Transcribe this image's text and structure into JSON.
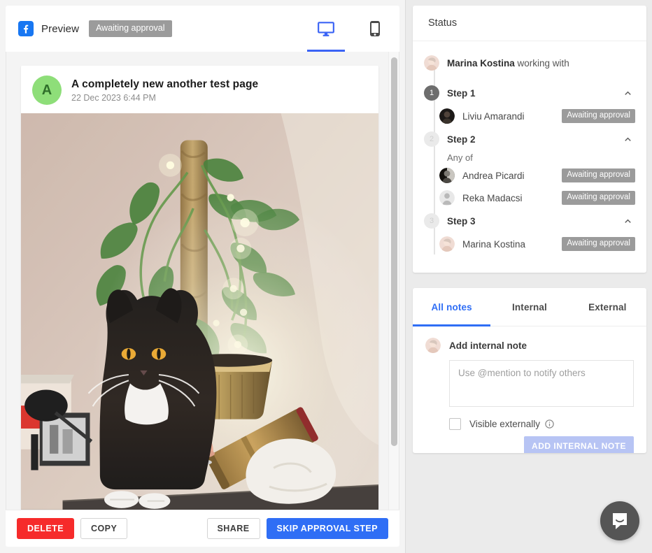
{
  "preview": {
    "network_icon": "facebook-icon",
    "title": "Preview",
    "status_chip": "Awaiting approval",
    "devices": [
      {
        "name": "desktop-icon",
        "active": true
      },
      {
        "name": "mobile-icon",
        "active": false
      }
    ],
    "post": {
      "avatar_letter": "A",
      "page_name": "A completely new another test page",
      "date": "22 Dec 2023 6:44 PM",
      "image_alt": "Black and white cat sitting on a dark sideboard in front of a pothos plant on a moss pole with fairy lights"
    },
    "footer": {
      "delete_label": "DELETE",
      "copy_label": "COPY",
      "share_label": "SHARE",
      "skip_label": "SKIP APPROVAL STEP"
    }
  },
  "status": {
    "heading": "Status",
    "owner_name": "Marina Kostina",
    "owner_suffix": " working with",
    "steps": [
      {
        "number": "1",
        "label": "Step 1",
        "state": "active",
        "any_of": null,
        "approvers": [
          {
            "name": "Liviu Amarandi",
            "badge": "Awaiting approval",
            "avatar": "avatar-dark"
          }
        ]
      },
      {
        "number": "2",
        "label": "Step 2",
        "state": "idle",
        "any_of": "Any of",
        "approvers": [
          {
            "name": "Andrea Picardi",
            "badge": "Awaiting approval",
            "avatar": "avatar-bw"
          },
          {
            "name": "Reka Madacsi",
            "badge": "Awaiting approval",
            "avatar": "avatar-placeholder"
          }
        ]
      },
      {
        "number": "3",
        "label": "Step 3",
        "state": "idle",
        "any_of": null,
        "approvers": [
          {
            "name": "Marina Kostina",
            "badge": "Awaiting approval",
            "avatar": "avatar-marina"
          }
        ]
      }
    ]
  },
  "notes": {
    "tabs": [
      {
        "label": "All notes",
        "active": true
      },
      {
        "label": "Internal",
        "active": false
      },
      {
        "label": "External",
        "active": false
      }
    ],
    "compose_label": "Add internal note",
    "placeholder": "Use @mention to notify others",
    "visible_externally_label": "Visible externally",
    "submit_label": "ADD INTERNAL NOTE"
  },
  "widgets": {
    "intercom_icon": "chat-bubble-icon"
  },
  "colors": {
    "brand_blue": "#2f6ef5",
    "facebook_blue": "#1877f2",
    "danger_red": "#f62b2b",
    "badge_gray": "#9b9b9b",
    "disabled_blue": "#b7c4f4",
    "page_bg": "#ebebeb"
  }
}
